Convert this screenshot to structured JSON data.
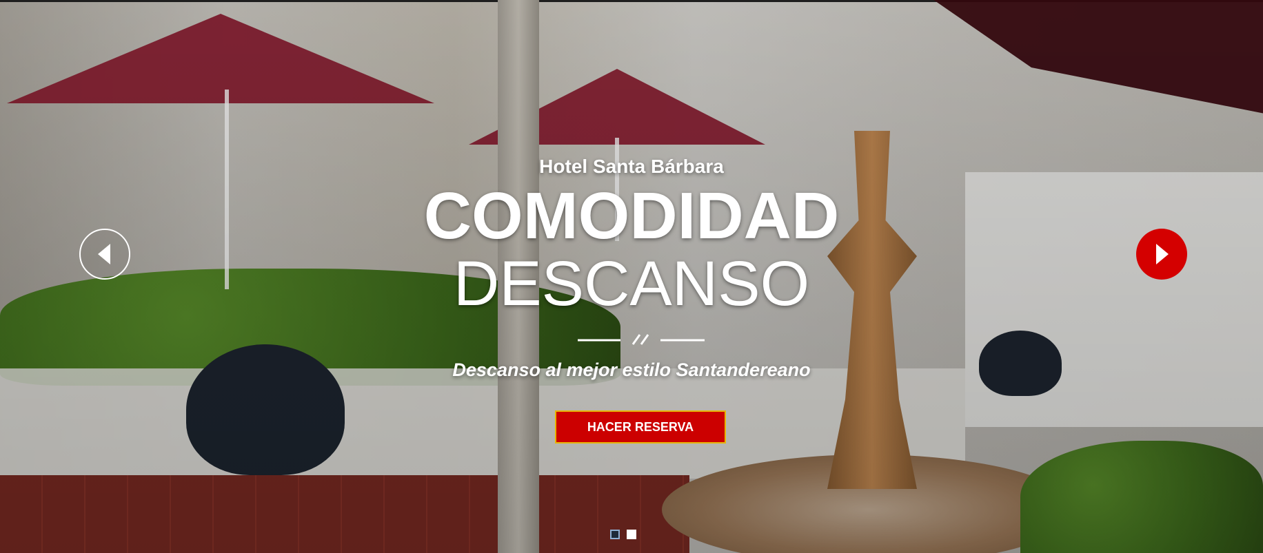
{
  "hero": {
    "subtitle": "Hotel Santa Bárbara",
    "title_line1": "COMODIDAD",
    "title_line2": "DESCANSO",
    "tagline": "Descanso al mejor estilo Santandereano",
    "cta_label": "HACER RESERVA"
  },
  "slider": {
    "prev_icon": "chevron-left-icon",
    "next_icon": "chevron-right-icon",
    "dots_count": 2,
    "active_dot": 1
  },
  "colors": {
    "accent": "#cc0000",
    "cta_border": "#e8b400",
    "text": "#ffffff"
  }
}
